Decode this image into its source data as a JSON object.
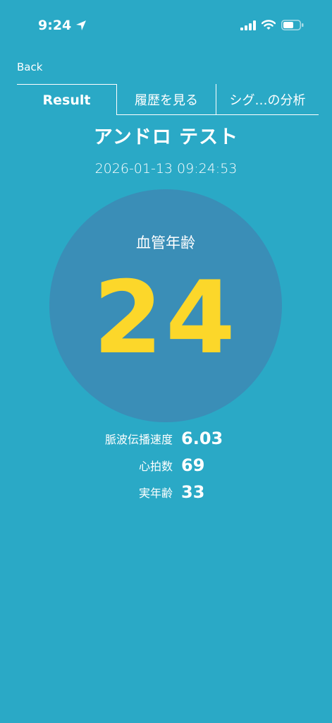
{
  "status_bar": {
    "time": "9:24"
  },
  "nav": {
    "back_label": "Back"
  },
  "tabs": [
    {
      "label": "Result",
      "active": true
    },
    {
      "label": "履歴を見る",
      "active": false
    },
    {
      "label": "シグ…の分析",
      "active": false
    }
  ],
  "result": {
    "title": "アンドロ テスト",
    "timestamp": "2026-01-13 09:24:53",
    "vascular_age_label": "血管年齢",
    "vascular_age_value": "24"
  },
  "metrics": [
    {
      "label": "脈波伝播速度",
      "value": "6.03"
    },
    {
      "label": "心拍数",
      "value": "69"
    },
    {
      "label": "実年齢",
      "value": "33"
    }
  ],
  "colors": {
    "background": "#2aa9c6",
    "circle": "#3a8eb7",
    "accent": "#fcd72a",
    "text": "#ffffff"
  }
}
